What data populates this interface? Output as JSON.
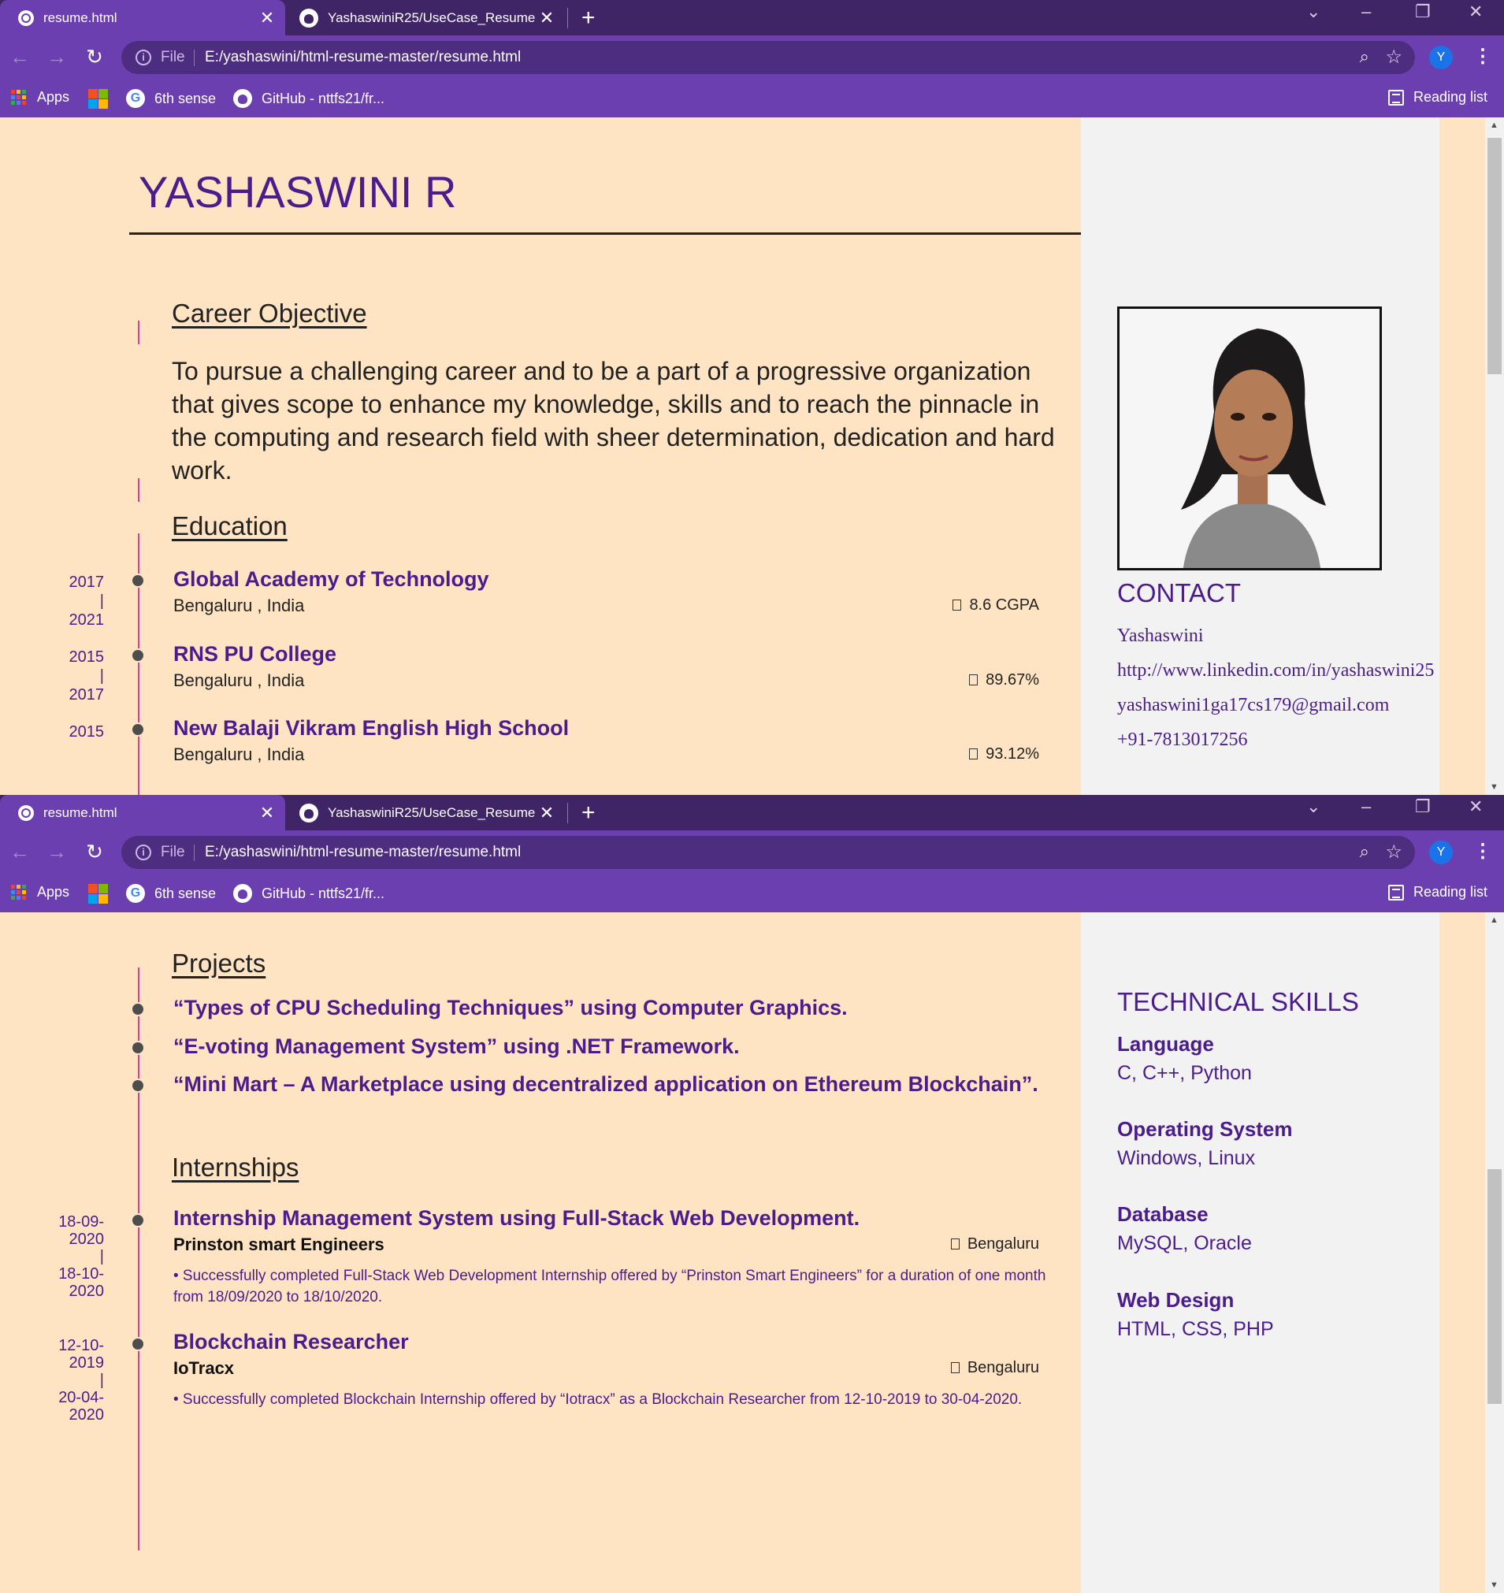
{
  "browser": {
    "active_tab_title": "resume.html",
    "inactive_tab_title": "YashaswiniR25/UseCase_Resume",
    "url_scheme": "File",
    "url": "E:/yashaswini/html-resume-master/resume.html",
    "profile_initial": "Y",
    "bookmarks": {
      "apps": "Apps",
      "sixth_sense": "6th sense",
      "github": "GitHub - nttfs21/fr...",
      "reading_list": "Reading list"
    }
  },
  "resume": {
    "name": "YASHASWINI R",
    "career_objective": {
      "title": "Career Objective",
      "text": "To pursue a challenging career and to be a part of a progressive organization that gives scope to enhance my knowledge, skills and to reach the pinnacle in the computing and research field with sheer determination, dedication and hard work."
    },
    "education": {
      "title": "Education",
      "items": [
        {
          "years": [
            "2017",
            "|",
            "2021"
          ],
          "institution": "Global Academy of Technology",
          "location": "Bengaluru , India",
          "score": "8.6 CGPA"
        },
        {
          "years": [
            "2015",
            "|",
            "2017"
          ],
          "institution": "RNS PU College",
          "location": "Bengaluru , India",
          "score": "89.67%"
        },
        {
          "years": [
            "2015"
          ],
          "institution": "New Balaji Vikram English High School",
          "location": "Bengaluru , India",
          "score": "93.12%"
        }
      ]
    },
    "contact": {
      "title": "CONTACT",
      "name": "Yashaswini",
      "linkedin": "http://www.linkedin.com/in/yashaswini25",
      "email": "yashaswini1ga17cs179@gmail.com",
      "phone": "+91-7813017256"
    },
    "projects": {
      "title": "Projects",
      "items": [
        "“Types of CPU Scheduling Techniques” using Computer Graphics.",
        "“E-voting Management System” using .NET Framework.",
        "“Mini Mart – A Marketplace using decentralized application on Ethereum Blockchain”."
      ]
    },
    "internships": {
      "title": "Internships",
      "items": [
        {
          "start": "18-09-2020",
          "start_a": "18-09-",
          "start_b": "2020",
          "end_a": "18-10-",
          "end_b": "2020",
          "title": "Internship Management System using Full-Stack Web Development.",
          "company": "Prinston smart Engineers",
          "location": "Bengaluru",
          "description": "• Successfully completed Full-Stack Web Development Internship offered by “Prinston Smart Engineers” for a duration of one month from 18/09/2020 to 18/10/2020."
        },
        {
          "start_a": "12-10-",
          "start_b": "2019",
          "end_a": "20-04-",
          "end_b": "2020",
          "title": "Blockchain Researcher",
          "company": "IoTracx",
          "location": "Bengaluru",
          "description": "• Successfully completed Blockchain Internship offered by “Iotracx” as a Blockchain Researcher from 12-10-2019 to 30-04-2020."
        }
      ]
    },
    "technical_skills": {
      "title": "TECHNICAL SKILLS",
      "groups": [
        {
          "label": "Language",
          "value": "C, C++, Python"
        },
        {
          "label": "Operating System",
          "value": "Windows, Linux"
        },
        {
          "label": "Database",
          "value": "MySQL, Oracle"
        },
        {
          "label": "Web Design",
          "value": "HTML, CSS, PHP"
        }
      ]
    }
  },
  "colors": {
    "accent": "#4a1c8c",
    "page_bg": "#ffe4c4",
    "timeline": "#d6409f",
    "chrome": "#6c3fb0"
  },
  "icons": [
    "globe-icon",
    "github-icon",
    "close-icon",
    "plus-icon",
    "back-icon",
    "forward-icon",
    "reload-icon",
    "info-icon",
    "zoom-icon",
    "star-icon",
    "kebab-icon",
    "apps-icon",
    "microsoft-icon",
    "google-icon",
    "reading-list-icon"
  ]
}
